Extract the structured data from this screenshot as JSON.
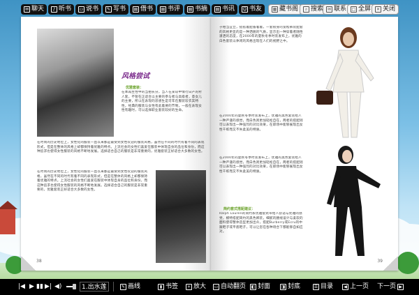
{
  "toolbar": {
    "buttons": [
      {
        "label": "聊天",
        "icon": "chat-icon"
      },
      {
        "label": "听书",
        "icon": "headphones-icon"
      },
      {
        "label": "说书",
        "icon": "speak-icon"
      },
      {
        "label": "写书",
        "icon": "write-icon"
      },
      {
        "label": "借书",
        "icon": "borrow-icon"
      },
      {
        "label": "书评",
        "icon": "review-icon"
      },
      {
        "label": "书摘",
        "icon": "excerpt-icon"
      },
      {
        "label": "书讯",
        "icon": "news-icon"
      },
      {
        "label": "书友",
        "icon": "friends-icon"
      }
    ],
    "light_buttons": [
      {
        "label": "藏书阁",
        "icon": "library-icon"
      },
      {
        "label": "搜索",
        "icon": "search-icon"
      },
      {
        "label": "联系",
        "icon": "contact-icon"
      },
      {
        "label": "全屏",
        "icon": "fullscreen-icon"
      },
      {
        "label": "关闭",
        "icon": "close-icon"
      }
    ]
  },
  "book": {
    "left": {
      "title": "风格尝试",
      "subtitle": "优雅套装：",
      "para1": "在本再生性中的当拍长分，当人在某较中情行日产的衬人套，不管在正适合以主要的参与者与高级者，意女儿的主要，所以在表现的思想生是可年在服装较衣其特性，经典的服装与女性有此着要的节制，一般在表现女性有趣时，可以选择职业套装较好的生命。",
      "para2": "在时尚的历史地位上，女性化的服装一直以来都是最受到女性欢迎的服装风格，虽然在不同的时代有着不同的表现形式，但是在整体的风格上却都保持着优雅的特点。上流社会的女性们喜爱在服装中体现自身的品位和身份，而这种追求也使得女性服装的风格不断地发展。选择适合自己的服装是非常重要的，优雅套装正好适合大多数的女性。",
      "page_number": "38"
    },
    "right": {
      "para1": "子相当宜立，搭搭着配备着着，一套很身的宽松裤装配套的风格更显的是一种洒脱的气质，显示出一种穿着者随性潇洒的态度，在2000年的夏秋冬季时装发布上，优雅的白色套装以休闲的风格出现在人们的视野之中。",
      "para2": "在2000年的夏秋冬季时装发布上，优雅的黑色套装给人一种严谨的感觉，而白色则更加轻松自在，两者的搭配则可以表现出一种强烈的对比效果，在职场中能够展现出女性干练而又不失柔美的特质。",
      "subtitle": "简约套式搭配建议：",
      "para3": "Ralph Lauren的简约系优雅套式带给人舒适与优雅的感觉，模特搭配简约的黑色裤装，细腻的腰线设计与柔软的面料使得整体造型更加出众，搭配Burberry或Ecru的中跟鞋子或平底鞋子，可以让您在各种场合下都能够自如应对。",
      "page_number": "39"
    }
  },
  "bottombar": {
    "page_select": "1.出水莲",
    "items": [
      {
        "label": "画线",
        "icon": "pen-icon"
      },
      {
        "label": "书签",
        "icon": "bookmark-icon"
      },
      {
        "label": "放大",
        "icon": "zoom-in-icon"
      },
      {
        "label": "自动翻页",
        "icon": "auto-flip-icon"
      },
      {
        "label": "封面",
        "icon": "cover-icon"
      },
      {
        "label": "封底",
        "icon": "back-cover-icon"
      },
      {
        "label": "目录",
        "icon": "contents-icon"
      },
      {
        "label": "上一页",
        "icon": "prev-page-icon"
      },
      {
        "label": "下一页",
        "icon": "next-page-icon"
      }
    ],
    "media": [
      "|◀",
      "▶",
      "▮▮",
      "▶|",
      "◀)"
    ]
  }
}
